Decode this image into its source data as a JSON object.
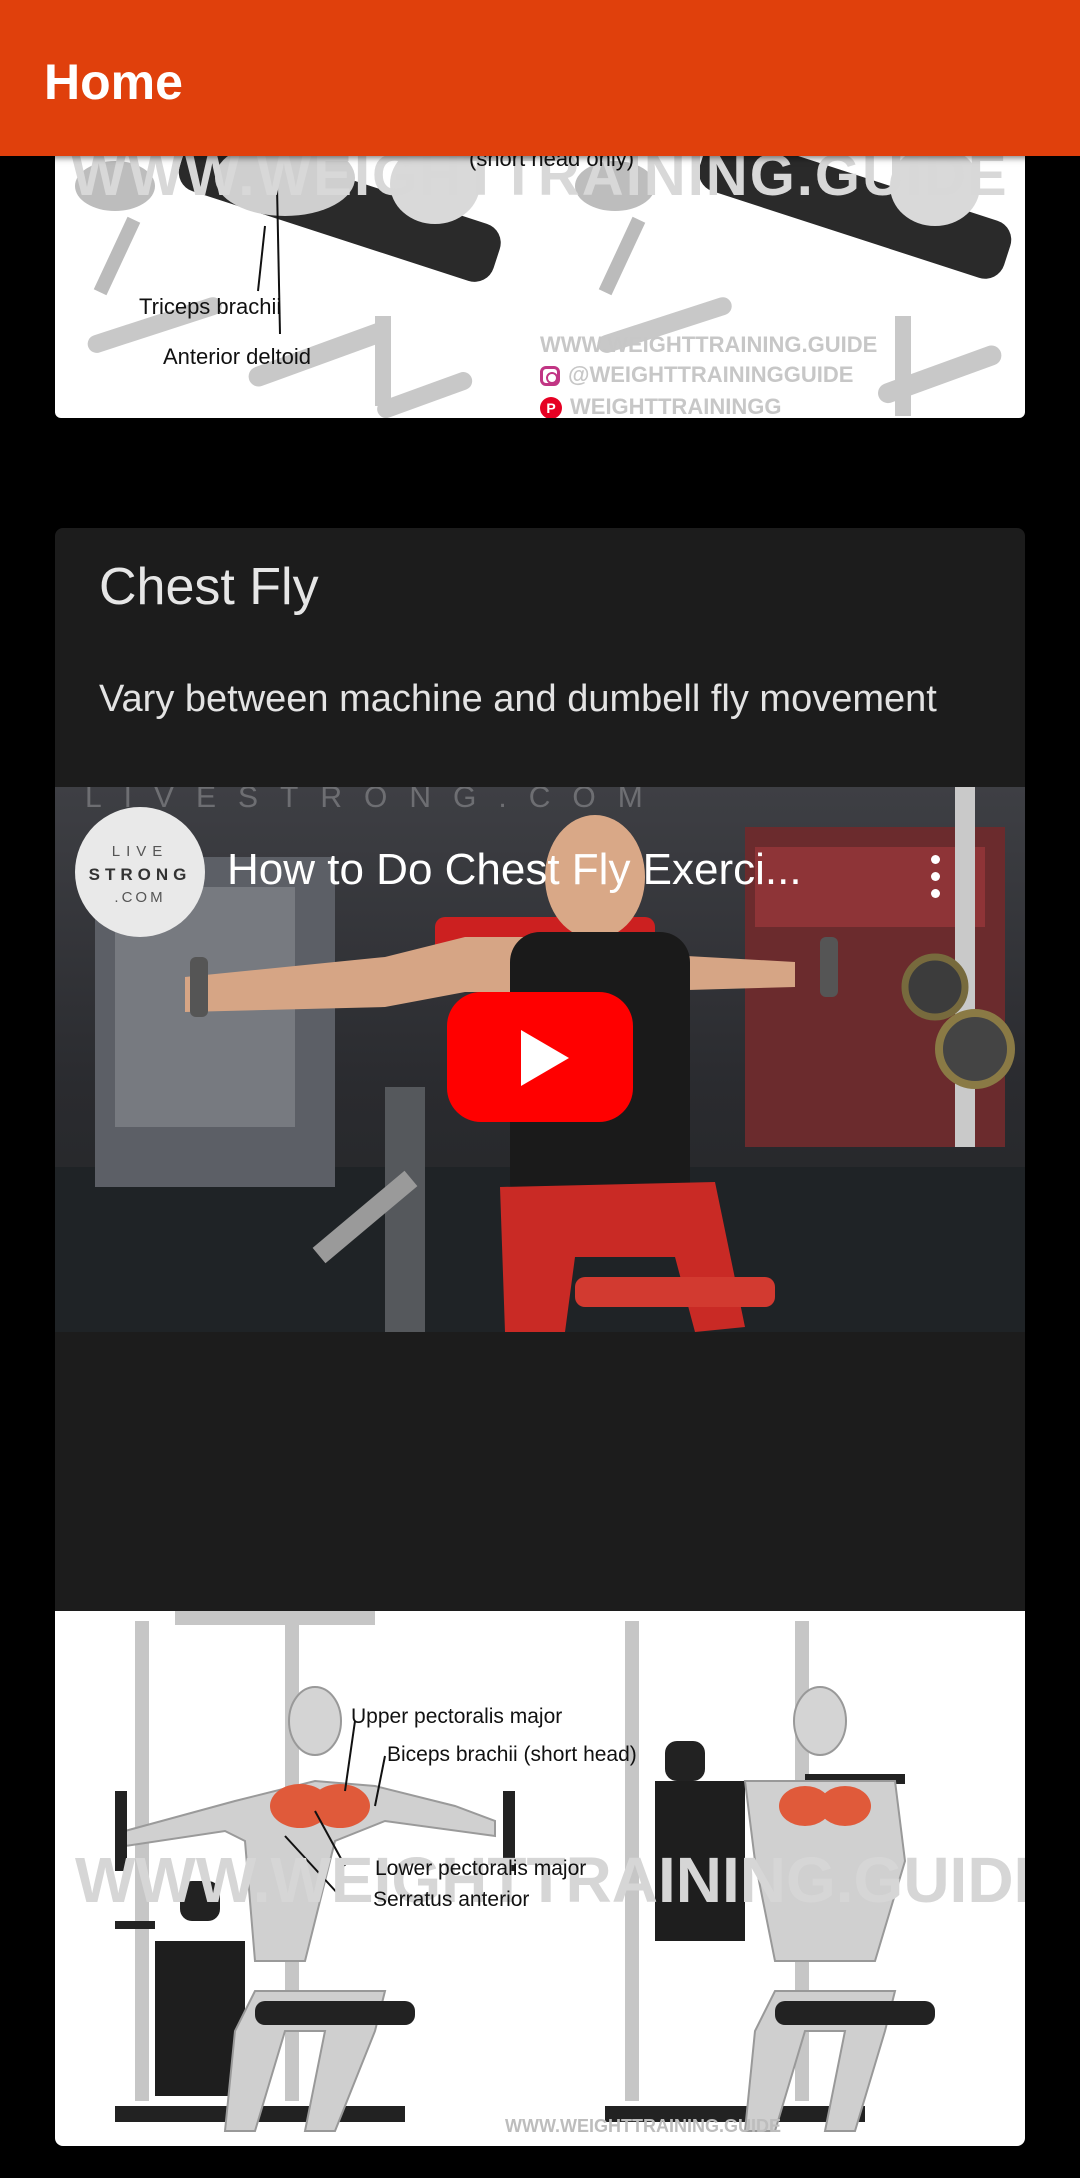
{
  "app_bar": {
    "title": "Home"
  },
  "top_card": {
    "watermark": "WWW.WEIGHTTRAINING.GUIDE",
    "labels": [
      "(short head only)",
      "Triceps brachii",
      "Anterior deltoid"
    ],
    "credits": {
      "site": "WWW.WEIGHTTRAINING.GUIDE",
      "instagram": "@WEIGHTTRAININGGUIDE",
      "pinterest": "WEIGHTTRAININGG"
    }
  },
  "exercise_card": {
    "title": "Chest Fly",
    "description": "Vary between machine and dumbell fly movement",
    "video": {
      "title": "How to Do Chest Fly Exerci...",
      "channel_logo": {
        "line1": "LIVE",
        "line2": "STRONG",
        "line3": ".COM"
      },
      "overlay_watermark": "LIVESTRONG.COM",
      "play_icon": "youtube-play-icon",
      "menu_icon": "more-vert-icon"
    },
    "diagram": {
      "watermark": "WWW.WEIGHTTRAINING.GUIDE",
      "labels": [
        "Upper pectoralis major",
        "Biceps brachii (short head)",
        "Lower pectoralis major",
        "Serratus anterior"
      ],
      "credit": "WWW.WEIGHTTRAINING.GUIDE"
    }
  },
  "colors": {
    "app_bar": "#E0400C",
    "background": "#000000",
    "card": "#1C1C1C",
    "youtube_red": "#FF0000"
  }
}
